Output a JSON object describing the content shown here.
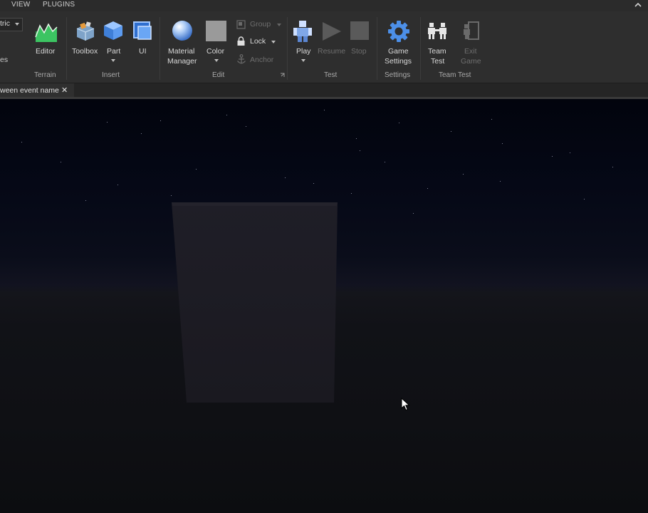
{
  "menu": {
    "tabs": [
      {
        "label": "VIEW"
      },
      {
        "label": "PLUGINS"
      }
    ]
  },
  "ribbon": {
    "left_partial": {
      "dropdown_label": "tric",
      "side_label": "es"
    },
    "terrain": {
      "editor_label": "Editor",
      "group_label": "Terrain"
    },
    "insert": {
      "toolbox_label": "Toolbox",
      "part_label": "Part",
      "ui_label": "UI",
      "group_label": "Insert"
    },
    "edit": {
      "material_label_1": "Material",
      "material_label_2": "Manager",
      "color_label": "Color",
      "group_label_item": "Group",
      "lock_label": "Lock",
      "anchor_label": "Anchor",
      "group_label": "Edit"
    },
    "test": {
      "play_label": "Play",
      "resume_label": "Resume",
      "stop_label": "Stop",
      "group_label": "Test"
    },
    "settings": {
      "game_settings_1": "Game",
      "game_settings_2": "Settings",
      "group_label": "Settings"
    },
    "team_test": {
      "team_test_1": "Team",
      "team_test_2": "Test",
      "exit_game_1": "Exit",
      "exit_game_2": "Game",
      "group_label": "Team Test"
    }
  },
  "document_tab": {
    "label": "ween event name",
    "close": "✕"
  },
  "colors": {
    "ribbon_bg": "#2e2e2e",
    "menubar_bg": "#2b2b2b",
    "accent_blue": "#4c8fe8",
    "terrain_green": "#3ab85a",
    "sky_top": "#02040d",
    "ground": "#111217",
    "part_color": "#1b1a22"
  },
  "icons": {
    "collapse": "chevron-up-icon",
    "terrain_editor": "terrain-icon",
    "toolbox": "toolbox-icon",
    "part": "cube-icon",
    "ui": "ui-frame-icon",
    "material": "sphere-icon",
    "color": "color-swatch-icon",
    "group": "group-icon",
    "lock": "lock-icon",
    "anchor": "anchor-icon",
    "play": "play-icon",
    "resume": "resume-icon",
    "stop": "stop-icon",
    "game_settings": "gear-icon",
    "team_test": "team-icon",
    "exit_game": "exit-game-icon",
    "cursor": "mouse-cursor-icon"
  }
}
